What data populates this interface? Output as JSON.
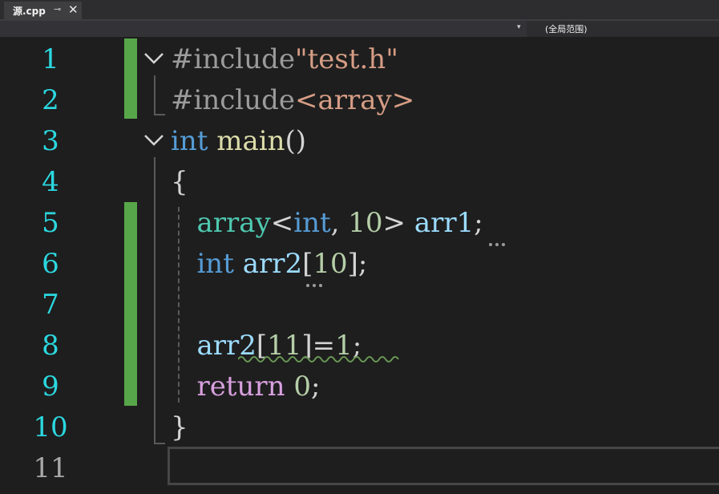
{
  "tab": {
    "filename": "源.cpp",
    "pin_icon": "⊸",
    "close_icon": "✕"
  },
  "nav": {
    "dropdown_icon": "▾",
    "scope": "(全局范围)"
  },
  "gutter": {
    "line_numbers": [
      "1",
      "2",
      "3",
      "4",
      "5",
      "6",
      "7",
      "8",
      "9",
      "10",
      "11"
    ]
  },
  "code": {
    "l1": {
      "directive": "#include",
      "path": "\"test.h\""
    },
    "l2": {
      "directive": "#include",
      "path": "<array>"
    },
    "l3": {
      "kw": "int",
      "name": "main",
      "parens": "()"
    },
    "l4": {
      "brace": "{"
    },
    "l5": {
      "type": "array",
      "lt": "<",
      "kw": "int",
      "comma": ",",
      "num": "10",
      "gt": ">",
      "var": "arr1",
      "semi": ";"
    },
    "l6": {
      "kw": "int",
      "var": "arr2",
      "bracket_open": "[",
      "num": "10",
      "bracket_close": "]",
      "semi": ";"
    },
    "l8": {
      "var": "arr2",
      "bracket_open": "[",
      "idx": "11",
      "bracket_close": "]",
      "eq": "=",
      "num": "1",
      "semi": ";"
    },
    "l9": {
      "kw": "return",
      "num": "0",
      "semi": ";"
    },
    "l10": {
      "brace": "}"
    }
  },
  "colors": {
    "background": "#1e1e1e",
    "line_number": "#2bd8e0",
    "change_bar": "#57a64a",
    "keyword": "#569cd6",
    "string": "#d69d85",
    "function": "#dcdcaa",
    "type": "#4ec9b0",
    "number": "#b5cea8",
    "variable": "#9cdcfe",
    "control_keyword": "#d8a0df",
    "error_squiggle": "#6a9955"
  }
}
